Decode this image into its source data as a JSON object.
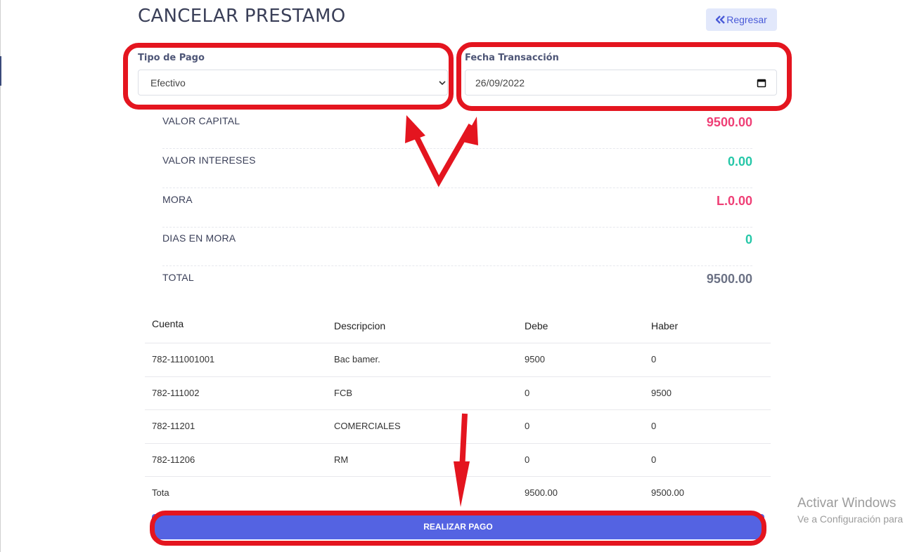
{
  "page": {
    "title": "CANCELAR PRESTAMO",
    "back_label": "Regresar"
  },
  "form": {
    "payment_type_label": "Tipo de Pago",
    "payment_type_value": "Efectivo",
    "date_label": "Fecha Transacción",
    "date_value": "26/09/2022"
  },
  "summary": [
    {
      "label": "VALOR CAPITAL",
      "value": "9500.00",
      "color": "#ef3f76"
    },
    {
      "label": "VALOR INTERESES",
      "value": "0.00",
      "color": "#26c7a8"
    },
    {
      "label": "MORA",
      "value": "L.0.00",
      "color": "#ef3f76"
    },
    {
      "label": "DIAS EN MORA",
      "value": "0",
      "color": "#26c7a8"
    },
    {
      "label": "TOTAL",
      "value": "9500.00",
      "color": "#6c7285"
    }
  ],
  "ledger": {
    "headers": [
      "Cuenta",
      "Descripcion",
      "Debe",
      "Haber"
    ],
    "rows": [
      [
        "782-111001001",
        "Bac bamer.",
        "9500",
        "0"
      ],
      [
        "782-111002",
        "FCB",
        "0",
        "9500"
      ],
      [
        "782-11201",
        "COMERCIALES",
        "0",
        "0"
      ],
      [
        "782-11206",
        "RM",
        "0",
        "0"
      ]
    ],
    "total": [
      "Tota",
      "",
      "9500.00",
      "9500.00"
    ]
  },
  "actions": {
    "pay_label": "REALIZAR PAGO"
  },
  "watermark": {
    "title": "Activar Windows",
    "subtitle": "Ve a Configuración para"
  },
  "icons": {
    "back": "double-chevron-left-icon",
    "select": "chevron-down-icon",
    "date": "calendar-icon"
  },
  "colors": {
    "accent": "#5463e2",
    "highlight": "#e4151f"
  }
}
